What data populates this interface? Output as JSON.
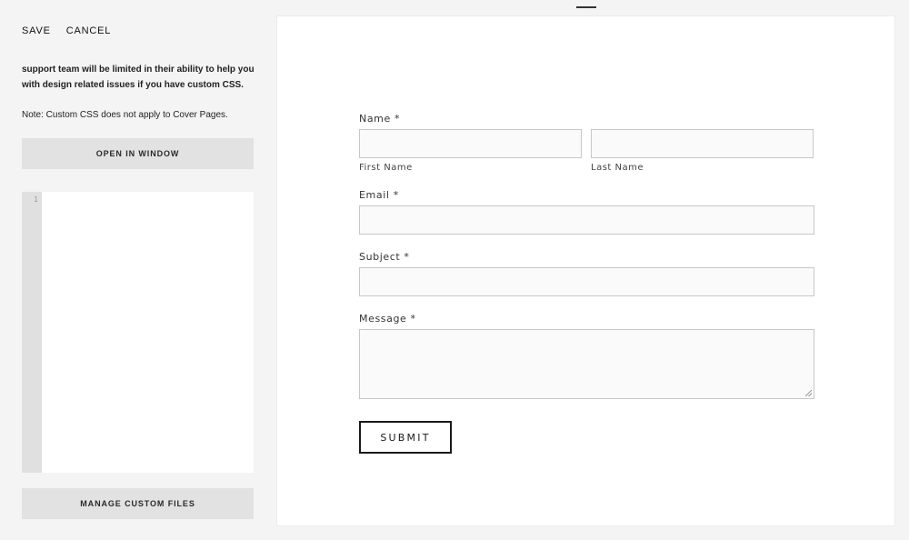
{
  "toolbar": {
    "save_label": "SAVE",
    "cancel_label": "CANCEL"
  },
  "panel": {
    "description": "support team will be limited in their ability to help you with design related issues if you have custom CSS.",
    "note": "Note: Custom CSS does not apply to Cover Pages.",
    "open_in_window_label": "OPEN IN WINDOW",
    "manage_files_label": "MANAGE CUSTOM FILES",
    "editor": {
      "line_numbers": [
        "1"
      ],
      "content": ""
    }
  },
  "form": {
    "name_label": "Name *",
    "first_name_label": "First Name",
    "last_name_label": "Last Name",
    "email_label": "Email *",
    "subject_label": "Subject *",
    "message_label": "Message *",
    "submit_label": "SUBMIT",
    "values": {
      "first_name": "",
      "last_name": "",
      "email": "",
      "subject": "",
      "message": ""
    }
  },
  "colors": {
    "panel_bg": "#f4f4f4",
    "button_bg": "#e2e2e2",
    "gutter_bg": "#e0e0e0",
    "input_bg": "#fafafa",
    "input_border": "#c8c8c8",
    "text": "#1e1e1e"
  },
  "icons": {
    "resize_grip": "resize-grip-icon",
    "drag_handle": "drag-handle-icon"
  }
}
